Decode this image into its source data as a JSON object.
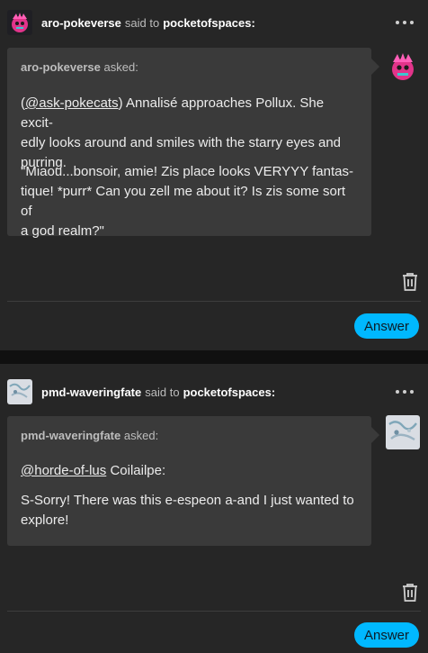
{
  "posts": [
    {
      "sender": "aro-pokeverse",
      "said_to_text": "said to",
      "recipient": "pocketofspaces:",
      "asker_name": "aro-pokeverse",
      "asked_label": "asked:",
      "p1_link": "@ask-pokecats",
      "p1_lines": [
        ") Annalisé approaches Pollux. She excit-",
        "edly looks around and smiles with the starry eyes and",
        "purring."
      ],
      "p2_lines": [
        "\"Miaou...bonsoir, amie! Zis place looks VERYYY fantas-",
        "tique! *purr* Can you zell me about it? Is zis some sort of",
        "a god realm?\""
      ],
      "answer_label": "Answer"
    },
    {
      "sender": "pmd-waveringfate",
      "said_to_text": "said to",
      "recipient": "pocketofspaces:",
      "asker_name": "pmd-waveringfate",
      "asked_label": "asked:",
      "p1_link": "@horde-of-lus",
      "p1_rest": " Coilailpe:",
      "p2_lines": [
        "S-Sorry! There was this e-espeon a-and I just wanted to",
        "explore!"
      ],
      "answer_label": "Answer"
    }
  ],
  "icons": [
    "more-options-icon",
    "trash-icon",
    "avatar-pink-creature",
    "avatar-sketch"
  ],
  "colors": {
    "accent": "#00b8ff",
    "card": "#262626",
    "bubble": "#3a3a3a",
    "page": "#101010"
  }
}
